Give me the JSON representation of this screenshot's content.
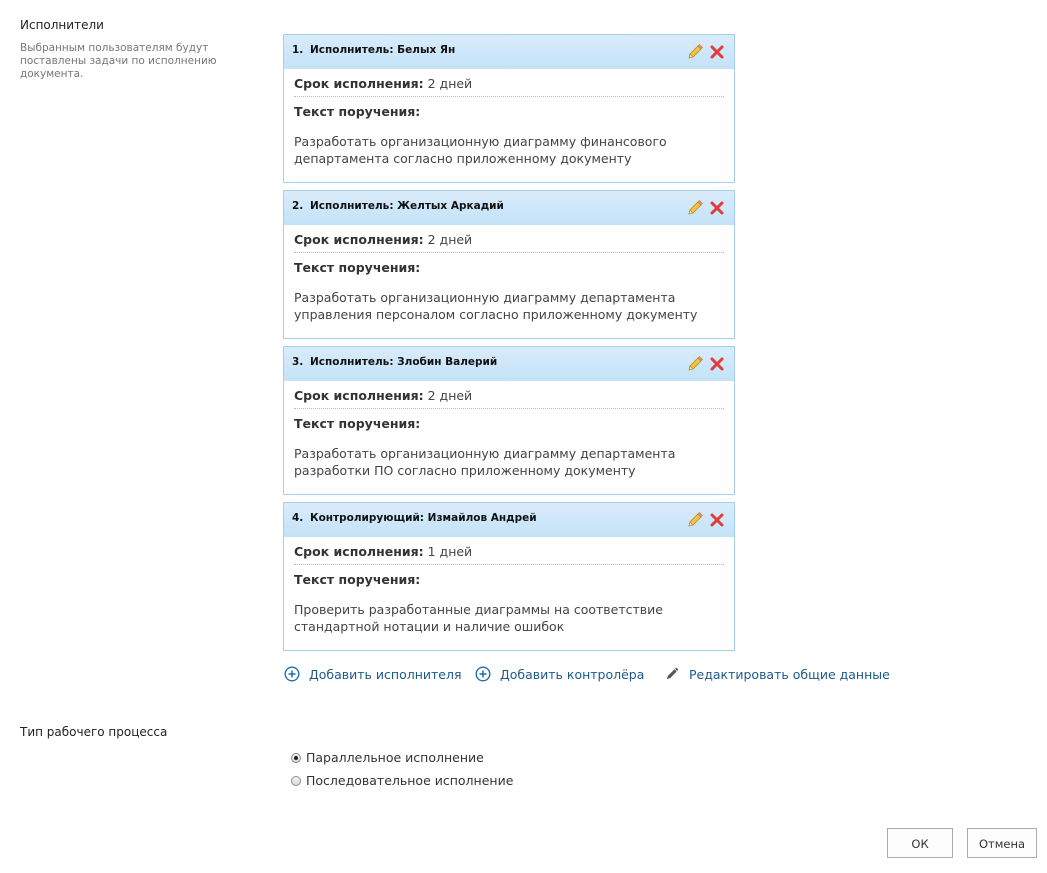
{
  "executors_section": {
    "title": "Исполнители",
    "description": "Выбранным пользователям будут поставлены задачи по исполнению документа."
  },
  "labels": {
    "term": "Срок исполнения:",
    "task_text": "Текст поручения:"
  },
  "assignments": [
    {
      "number": "1.",
      "title": "Исполнитель: Белых Ян",
      "term_value": "2 дней",
      "text": "Разработать организационную диаграмму финансового департамента согласно приложенному документу"
    },
    {
      "number": "2.",
      "title": "Исполнитель: Желтых Аркадий",
      "term_value": "2 дней",
      "text": "Разработать организационную диаграмму департамента управления персоналом согласно приложенному документу"
    },
    {
      "number": "3.",
      "title": "Исполнитель: Злобин Валерий",
      "term_value": "2 дней",
      "text": "Разработать организационную диаграмму департамента разработки ПО согласно приложенному документу"
    },
    {
      "number": "4.",
      "title": "Контролирующий: Измайлов Андрей",
      "term_value": "1 дней",
      "text": "Проверить разработанные диаграммы на соответствие стандартной нотации и наличие ошибок"
    }
  ],
  "actions": {
    "add_executor": "Добавить исполнителя",
    "add_controller": "Добавить контролёра",
    "edit_common": "Редактировать общие данные"
  },
  "workflow_section": {
    "title": "Тип рабочего процесса",
    "options": [
      "Параллельное исполнение",
      "Последовательное исполнение"
    ],
    "selected": "Параллельное исполнение"
  },
  "buttons": {
    "ok": "ОК",
    "cancel": "Отмена"
  },
  "colors": {
    "header_blue": "#c4e2f8",
    "border_blue": "#a6cfe9",
    "link_blue": "#1d5a8a",
    "delete_red": "#e23b3b",
    "pencil_yellow": "#f0c030"
  },
  "icons": {
    "edit": "pencil-icon",
    "delete": "close-x-icon",
    "add": "plus-circle-icon",
    "edit_common": "pencil-icon"
  }
}
